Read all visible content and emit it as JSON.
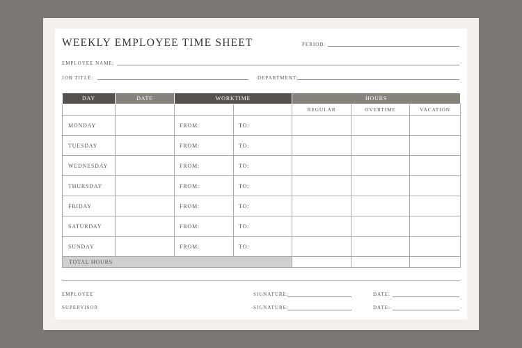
{
  "header": {
    "title": "WEEKLY EMPLOYEE TIME SHEET",
    "period_label": "PERIOD:",
    "employee_name_label": "EMPLOYEE NAME:",
    "job_title_label": "JOB TITLE:",
    "department_label": "DEPARTMENT:"
  },
  "table": {
    "headers": {
      "day": "DAY",
      "date": "DATE",
      "worktime": "WORKTIME",
      "hours": "HOURS"
    },
    "sub_headers": {
      "regular": "REGULAR",
      "overtime": "OVERTIME",
      "vacation": "VACATION"
    },
    "from_label": "FROM:",
    "to_label": "TO:",
    "days": [
      "MONDAY",
      "TUESDAY",
      "WEDNESDAY",
      "THURSDAY",
      "FRIDAY",
      "SATURDAY",
      "SUNDAY"
    ],
    "total_label": "TOTAL HOURS"
  },
  "footer": {
    "employee_label": "EMPLOYEE",
    "supervisor_label": "SUPERVISOR",
    "signature_label": "SIGNATURE:",
    "date_label": "DATE:"
  },
  "colors": {
    "background": "#797674",
    "paper": "#f5f0eb",
    "header_dark": "#57524e",
    "header_mid": "#88827d",
    "total_fill": "#d2d0ce"
  }
}
